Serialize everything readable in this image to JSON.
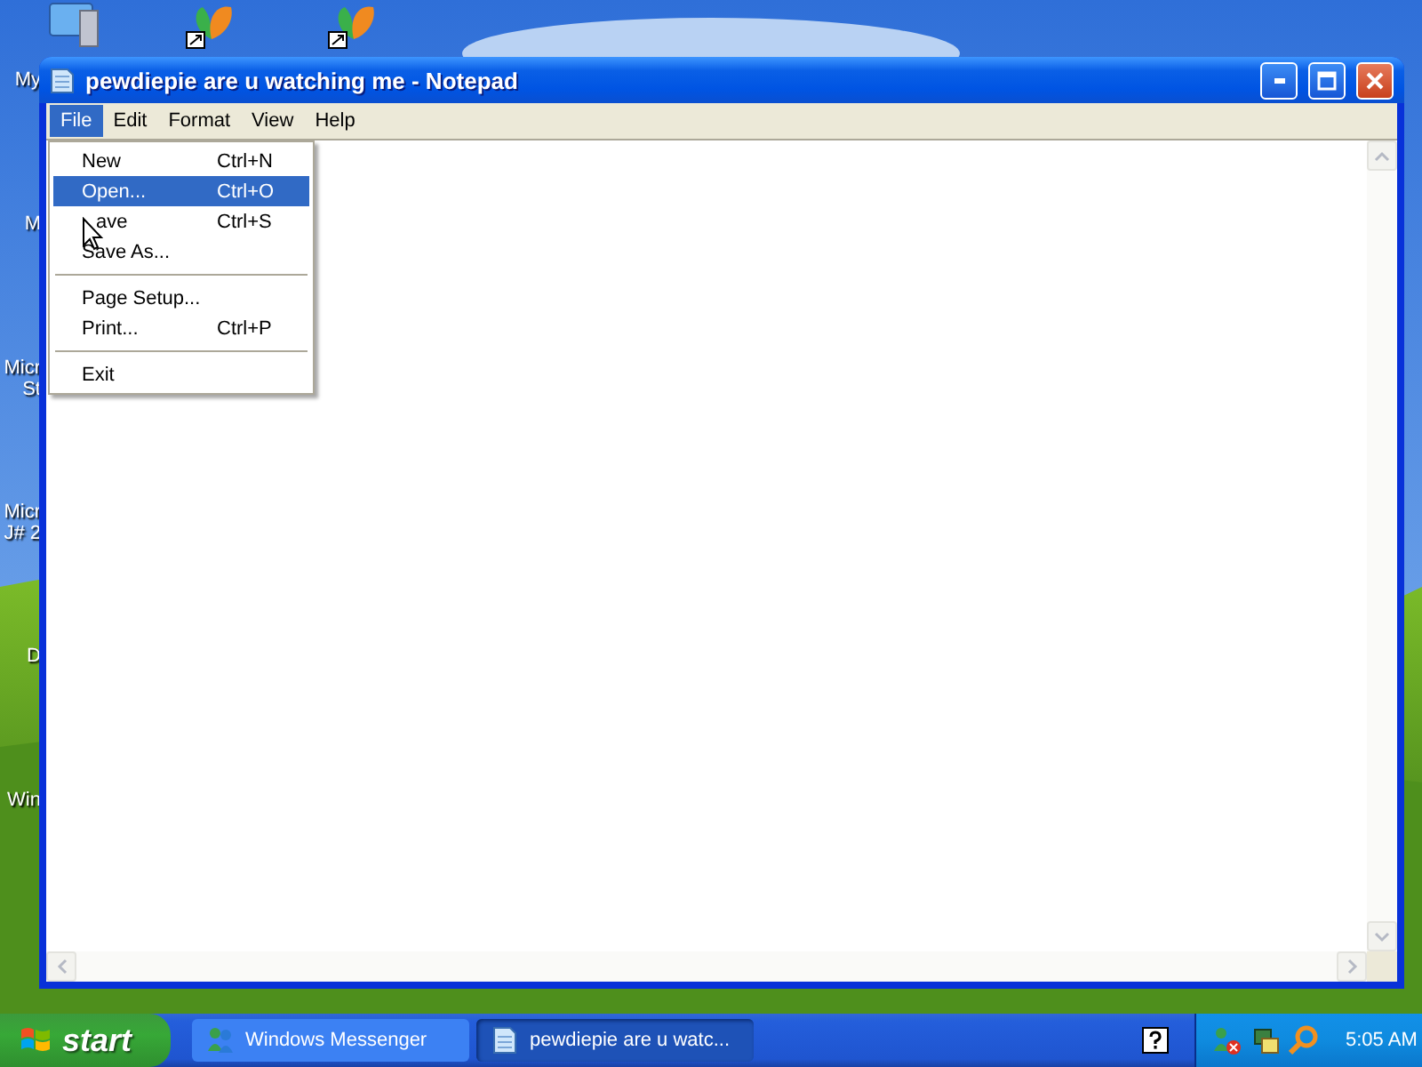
{
  "desktop_icons": [
    {
      "lines": [
        "My"
      ]
    },
    {
      "lines": [
        "M"
      ]
    },
    {
      "lines": [
        "Micr",
        "St"
      ]
    },
    {
      "lines": [
        "Micr",
        "J# 2"
      ]
    },
    {
      "lines": [
        "D"
      ]
    },
    {
      "lines": [
        "Win"
      ]
    }
  ],
  "window": {
    "title": "pewdiepie are u watching me - Notepad",
    "active": true
  },
  "menubar": [
    {
      "label": "File",
      "selected": true
    },
    {
      "label": "Edit",
      "selected": false
    },
    {
      "label": "Format",
      "selected": false
    },
    {
      "label": "View",
      "selected": false
    },
    {
      "label": "Help",
      "selected": false
    }
  ],
  "file_menu": [
    {
      "kind": "item",
      "label": "New",
      "shortcut": "Ctrl+N",
      "selected": false
    },
    {
      "kind": "item",
      "label": "Open...",
      "shortcut": "Ctrl+O",
      "selected": true
    },
    {
      "kind": "item",
      "label": "ave",
      "shortcut": "Ctrl+S",
      "selected": false,
      "cursor": true
    },
    {
      "kind": "item",
      "label": "Save As...",
      "selected": false
    },
    {
      "kind": "separator"
    },
    {
      "kind": "item",
      "label": "Page Setup...",
      "selected": false
    },
    {
      "kind": "item",
      "label": "Print...",
      "shortcut": "Ctrl+P",
      "selected": false
    },
    {
      "kind": "separator"
    },
    {
      "kind": "item",
      "label": "Exit",
      "selected": false
    }
  ],
  "taskbar": {
    "start": "start",
    "tasks": [
      {
        "label": "Windows Messenger",
        "active": false
      },
      {
        "label": "pewdiepie are u watc...",
        "active": true
      }
    ],
    "clock": "5:05 AM"
  }
}
